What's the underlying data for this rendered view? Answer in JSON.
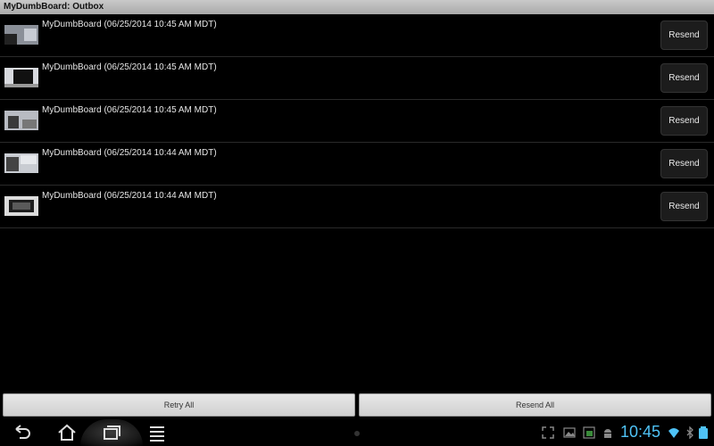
{
  "window": {
    "title": "MyDumbBoard: Outbox"
  },
  "outbox": {
    "items": [
      {
        "label": "MyDumbBoard (06/25/2014 10:45 AM MDT)",
        "action": "Resend"
      },
      {
        "label": "MyDumbBoard (06/25/2014 10:45 AM MDT)",
        "action": "Resend"
      },
      {
        "label": "MyDumbBoard (06/25/2014 10:45 AM MDT)",
        "action": "Resend"
      },
      {
        "label": "MyDumbBoard (06/25/2014 10:44 AM MDT)",
        "action": "Resend"
      },
      {
        "label": "MyDumbBoard (06/25/2014 10:44 AM MDT)",
        "action": "Resend"
      }
    ]
  },
  "actions": {
    "retry_all": "Retry All",
    "resend_all": "Resend All"
  },
  "system": {
    "clock": "10:45",
    "icons": [
      "back-icon",
      "home-icon",
      "recent-apps-icon",
      "menu-icon",
      "fullscreen-icon",
      "gallery-icon",
      "screenshot-icon",
      "android-icon",
      "wifi-icon",
      "bluetooth-icon",
      "battery-icon"
    ],
    "accent_color": "#4fc3f7"
  }
}
